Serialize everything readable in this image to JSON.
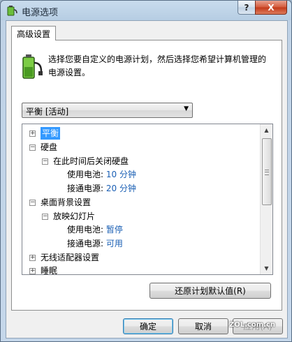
{
  "window": {
    "title": "电源选项",
    "help_label": "?",
    "close_label": "X"
  },
  "tab": {
    "label": "高级设置"
  },
  "description": "选择您要自定义的电源计划，然后选择您希望计算机管理的电源设置。",
  "plan_select": {
    "value": "平衡 [活动]"
  },
  "tree": {
    "items": [
      {
        "label": "平衡",
        "toggle": "+",
        "value": ""
      },
      {
        "label": "硬盘",
        "toggle": "−",
        "value": ""
      },
      {
        "label": "在此时间后关闭硬盘",
        "toggle": "−",
        "value": ""
      },
      {
        "label": "使用电池: ",
        "toggle": "",
        "value": "10 分钟"
      },
      {
        "label": "接通电源: ",
        "toggle": "",
        "value": "20 分钟"
      },
      {
        "label": "桌面背景设置",
        "toggle": "−",
        "value": ""
      },
      {
        "label": "放映幻灯片",
        "toggle": "−",
        "value": ""
      },
      {
        "label": "使用电池: ",
        "toggle": "",
        "value": "暂停"
      },
      {
        "label": "接通电源: ",
        "toggle": "",
        "value": "可用"
      },
      {
        "label": "无线适配器设置",
        "toggle": "+",
        "value": ""
      },
      {
        "label": "睡眠",
        "toggle": "+",
        "value": ""
      }
    ]
  },
  "buttons": {
    "restore": "还原计划默认值(R)",
    "ok": "确定",
    "cancel": "取消",
    "apply": "应用(A)"
  },
  "watermark": "ZOL.com.cn",
  "colors": {
    "value_text": "#1a5fb4",
    "selection": "#3399ff"
  },
  "icons": {
    "title": "battery-plug-icon",
    "description": "battery-plug-icon"
  }
}
